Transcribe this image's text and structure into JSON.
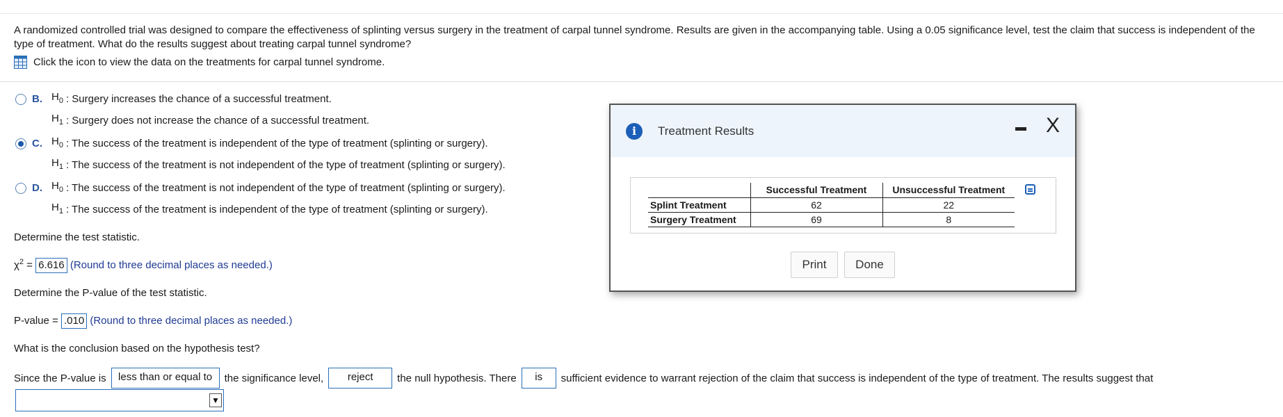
{
  "question": {
    "text": "A randomized controlled trial was designed to compare the effectiveness of splinting versus surgery in the treatment of carpal tunnel syndrome. Results are given in the accompanying table. Using a 0.05 significance level, test the claim that success is independent of the type of treatment. What do the results suggest about treating carpal tunnel syndrome?",
    "hint": "Click the icon to view the data on the treatments for carpal tunnel syndrome.",
    "hint_icon": "table-grid-icon"
  },
  "options": [
    {
      "letter": "B.",
      "selected": false,
      "h0_label": "H",
      "h0_sub": "0",
      "h0_text": ": Surgery increases the chance of a successful treatment.",
      "h1_label": "H",
      "h1_sub": "1",
      "h1_text": ": Surgery does not increase the chance of a successful treatment."
    },
    {
      "letter": "C.",
      "selected": true,
      "h0_label": "H",
      "h0_sub": "0",
      "h0_text": ": The success of the treatment is independent of the type of treatment (splinting or surgery).",
      "h1_label": "H",
      "h1_sub": "1",
      "h1_text": ": The success of the treatment is not independent of the type of treatment (splinting or surgery)."
    },
    {
      "letter": "D.",
      "selected": false,
      "h0_label": "H",
      "h0_sub": "0",
      "h0_text": ": The success of the treatment is not independent of the type of treatment (splinting or surgery).",
      "h1_label": "H",
      "h1_sub": "1",
      "h1_text": ": The success of the treatment is independent of the type of treatment (splinting or surgery)."
    }
  ],
  "test_stat": {
    "prompt": "Determine the test statistic.",
    "symbol": "χ",
    "sup": "2",
    "equals": " = ",
    "value": "6.616",
    "note": "(Round to three decimal places as needed.)"
  },
  "pvalue": {
    "prompt": "Determine the P-value of the test statistic.",
    "label": "P-value = ",
    "value": ".010",
    "note": "(Round to three decimal places as needed.)"
  },
  "conclusion": {
    "prompt": "What is the conclusion based on the hypothesis test?",
    "part1": "Since the P-value is",
    "choice1": "less than or equal to",
    "part2": "the significance level,",
    "choice2": "reject",
    "part3": "the null hypothesis. There",
    "choice3": "is",
    "part4": "sufficient evidence to warrant rejection of the claim that success is independent of the type of treatment. The results suggest that",
    "dropdown_value": "",
    "dropdown_arrow": "▼"
  },
  "modal": {
    "title": "Treatment Results",
    "info_icon": "i",
    "close_glyph": "X",
    "table": {
      "columns": [
        "Successful Treatment",
        "Unsuccessful Treatment"
      ],
      "rows": [
        {
          "label": "Splint Treatment",
          "values": [
            "62",
            "22"
          ]
        },
        {
          "label": "Surgery Treatment",
          "values": [
            "69",
            "8"
          ]
        }
      ]
    },
    "print_label": "Print",
    "done_label": "Done"
  },
  "colors": {
    "accent": "#1c5fb8",
    "note": "#1f3a93"
  }
}
